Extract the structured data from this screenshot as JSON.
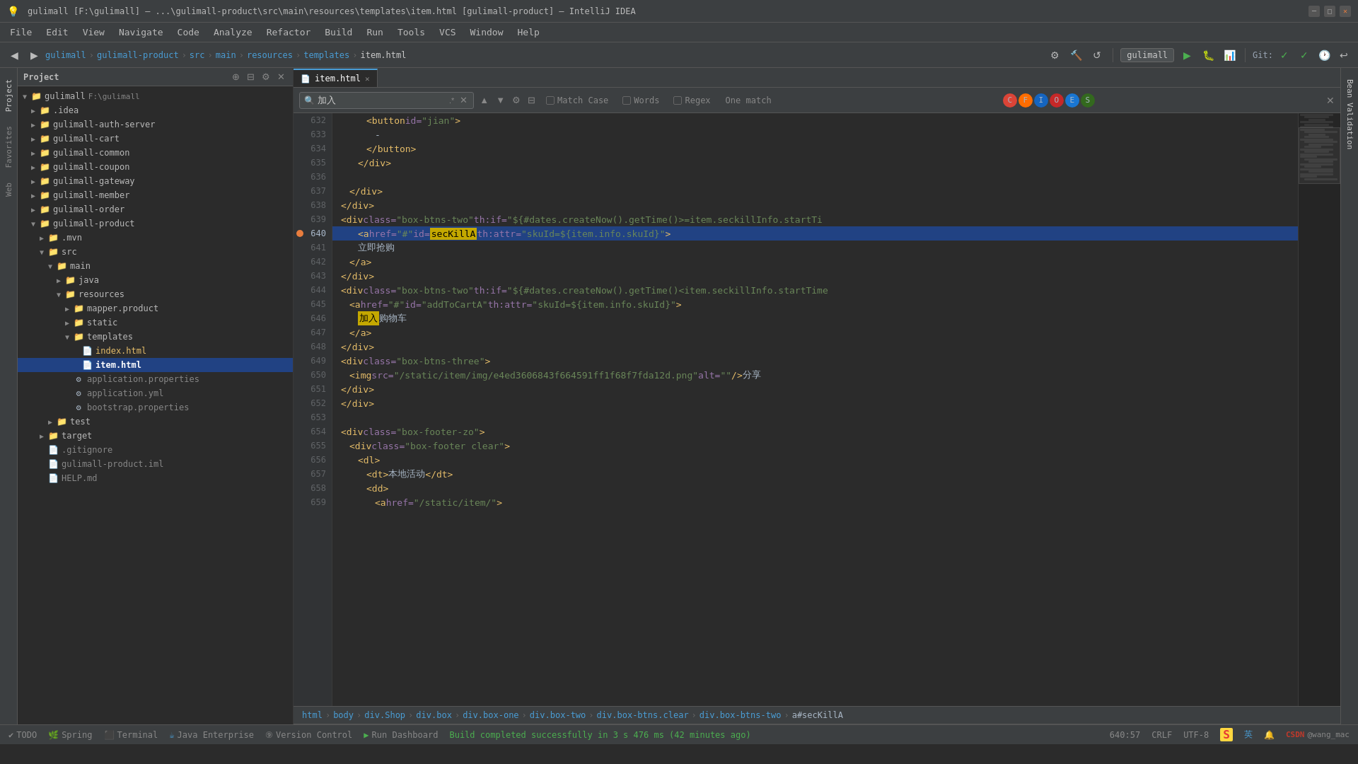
{
  "titleBar": {
    "title": "gulimall [F:\\gulimall] – ...\\gulimall-product\\src\\main\\resources\\templates\\item.html [gulimall-product] – IntelliJ IDEA",
    "windowControls": [
      "minimize",
      "maximize",
      "close"
    ]
  },
  "menuBar": {
    "items": [
      "File",
      "Edit",
      "View",
      "Navigate",
      "Code",
      "Analyze",
      "Refactor",
      "Build",
      "Run",
      "Tools",
      "VCS",
      "Window",
      "Help"
    ]
  },
  "toolbar": {
    "breadcrumb": {
      "items": [
        "gulimall",
        "gulimall-product",
        "src",
        "main",
        "resources",
        "templates",
        "item.html"
      ]
    },
    "runConfig": "gulimall",
    "gitLabel": "Git:"
  },
  "tabs": {
    "items": [
      {
        "name": "item.html",
        "active": true
      }
    ]
  },
  "findBar": {
    "searchText": "加入",
    "matchCase": "Match Case",
    "words": "Words",
    "regex": "Regex",
    "matchInfo": "One match"
  },
  "projectPanel": {
    "title": "Project",
    "rootNode": "gulimall F:\\gulimall",
    "items": [
      {
        "indent": 0,
        "type": "dir",
        "name": "gulimall",
        "expanded": true
      },
      {
        "indent": 1,
        "type": "dir",
        "name": ".idea",
        "expanded": false
      },
      {
        "indent": 1,
        "type": "dir",
        "name": "gulimall-auth-server",
        "expanded": false
      },
      {
        "indent": 1,
        "type": "dir",
        "name": "gulimall-cart",
        "expanded": false
      },
      {
        "indent": 1,
        "type": "dir",
        "name": "gulimall-common",
        "expanded": false
      },
      {
        "indent": 1,
        "type": "dir",
        "name": "gulimall-coupon",
        "expanded": false
      },
      {
        "indent": 1,
        "type": "dir",
        "name": "gulimall-gateway",
        "expanded": false
      },
      {
        "indent": 1,
        "type": "dir",
        "name": "gulimall-member",
        "expanded": false
      },
      {
        "indent": 1,
        "type": "dir",
        "name": "gulimall-order",
        "expanded": false
      },
      {
        "indent": 1,
        "type": "dir",
        "name": "gulimall-product",
        "expanded": true,
        "selected": false
      },
      {
        "indent": 2,
        "type": "dir",
        "name": ".mvn",
        "expanded": false
      },
      {
        "indent": 2,
        "type": "dir",
        "name": "src",
        "expanded": true
      },
      {
        "indent": 3,
        "type": "dir",
        "name": "main",
        "expanded": true
      },
      {
        "indent": 4,
        "type": "dir",
        "name": "java",
        "expanded": false
      },
      {
        "indent": 4,
        "type": "dir",
        "name": "resources",
        "expanded": true
      },
      {
        "indent": 5,
        "type": "dir",
        "name": "mapper.product",
        "expanded": false
      },
      {
        "indent": 5,
        "type": "dir",
        "name": "static",
        "expanded": false
      },
      {
        "indent": 5,
        "type": "dir",
        "name": "templates",
        "expanded": true
      },
      {
        "indent": 6,
        "type": "html",
        "name": "index.html"
      },
      {
        "indent": 6,
        "type": "html-selected",
        "name": "item.html",
        "selected": true
      },
      {
        "indent": 5,
        "type": "properties",
        "name": "application.properties"
      },
      {
        "indent": 5,
        "type": "properties",
        "name": "application.yml"
      },
      {
        "indent": 5,
        "type": "properties",
        "name": "bootstrap.properties"
      },
      {
        "indent": 3,
        "type": "dir",
        "name": "test",
        "expanded": false
      },
      {
        "indent": 2,
        "type": "dir",
        "name": "target",
        "expanded": false
      },
      {
        "indent": 2,
        "type": "file",
        "name": ".gitignore"
      },
      {
        "indent": 2,
        "type": "file",
        "name": "gulimall-product.iml"
      },
      {
        "indent": 2,
        "type": "file",
        "name": "HELP.md"
      }
    ]
  },
  "codeLines": [
    {
      "num": 632,
      "content": "            <button id=\"jian\">"
    },
    {
      "num": 633,
      "content": "                -"
    },
    {
      "num": 634,
      "content": "            </button>"
    },
    {
      "num": 635,
      "content": "        </div>"
    },
    {
      "num": 636,
      "content": ""
    },
    {
      "num": 637,
      "content": "    </div>"
    },
    {
      "num": 638,
      "content": "</div>"
    },
    {
      "num": 639,
      "content": "<div class=\"box-btns-two\" th:if=\"${#dates.createNow().getTime()>=item.seckillInfo.startTi"
    },
    {
      "num": 640,
      "content": "    <a href=\"#\" id=\"secKillA\" th:attr=\"skuId=${item.info.skuId}\">",
      "hasGutter": true,
      "highlighted": true
    },
    {
      "num": 641,
      "content": "        立即抢购"
    },
    {
      "num": 642,
      "content": "    </a>"
    },
    {
      "num": 643,
      "content": "</div>"
    },
    {
      "num": 644,
      "content": "<div class=\"box-btns-two\" th:if=\"${#dates.createNow().getTime()<item.seckillInfo.startTime"
    },
    {
      "num": 645,
      "content": "    <a href=\"#\" id=\"addToCartA\" th:attr=\"skuId=${item.info.skuId}\">"
    },
    {
      "num": 646,
      "content": "        加入购物车"
    },
    {
      "num": 647,
      "content": "    </a>"
    },
    {
      "num": 648,
      "content": "</div>"
    },
    {
      "num": 649,
      "content": "<div class=\"box-btns-three\">"
    },
    {
      "num": 650,
      "content": "    <img src=\"/static/item/img/e4ed3606843f664591ff1f68f7fda12d.png\" alt=\"\" /> 分享"
    },
    {
      "num": 651,
      "content": "</div>"
    },
    {
      "num": 652,
      "content": "</div>"
    },
    {
      "num": 653,
      "content": ""
    },
    {
      "num": 654,
      "content": "<div class=\"box-footer-zo\">"
    },
    {
      "num": 655,
      "content": "    <div class=\"box-footer clear\">"
    },
    {
      "num": 656,
      "content": "        <dl>"
    },
    {
      "num": 657,
      "content": "            <dt>本地活动</dt>"
    },
    {
      "num": 658,
      "content": "            <dd>"
    },
    {
      "num": 659,
      "content": "                <a href=\"/static/item/\">"
    }
  ],
  "statusBar": {
    "todo": "TODO",
    "spring": "Spring",
    "terminal": "Terminal",
    "javaEnterprise": "Java Enterprise",
    "versionControl": "Version Control",
    "runDashboard": "Run Dashboard",
    "position": "640:57",
    "lineEnding": "CRLF",
    "encoding": "UTF-8",
    "sLabel": "S",
    "langLabel": "英",
    "buildStatus": "Build completed successfully in 3 s 476 ms (42 minutes ago)"
  },
  "bottomBreadcrumb": {
    "items": [
      "html",
      "body",
      "div.Shop",
      "div.box",
      "div.box-one",
      "div.box-two",
      "div.box-btns.clear",
      "div.box-btns-two",
      "a#secKillA"
    ]
  }
}
